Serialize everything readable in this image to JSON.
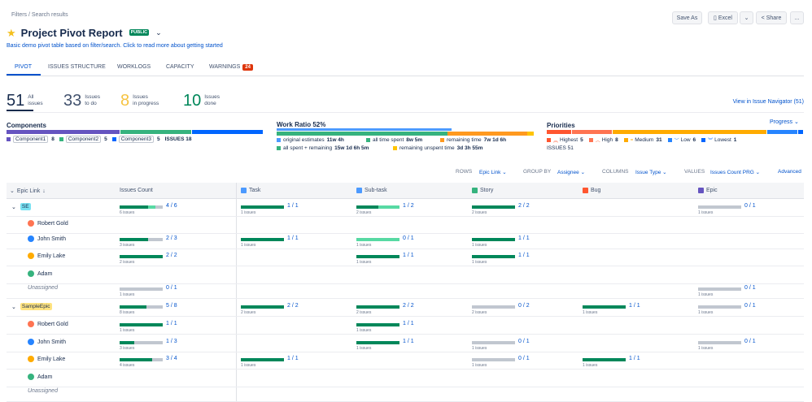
{
  "header": {
    "breadcrumb": "Filters  / Search results",
    "title": "Project Pivot Report",
    "badge": "PUBLIC",
    "subtitle": "Basic demo pivot table based on filter/search. Click to read more about getting started",
    "buttons": {
      "save_as": "Save As",
      "excel": "Excel",
      "share": "Share",
      "more": "..."
    }
  },
  "tabs": [
    {
      "label": "PIVOT"
    },
    {
      "label": "ISSUES STRUCTURE"
    },
    {
      "label": "WORKLOGS"
    },
    {
      "label": "CAPACITY"
    },
    {
      "label": "WARNINGS",
      "badge": "24"
    }
  ],
  "stats": [
    {
      "value": "51",
      "label1": "All",
      "label2": "issues",
      "color": "#172b4d"
    },
    {
      "value": "33",
      "label1": "Issues",
      "label2": "to do",
      "color": "#42526e"
    },
    {
      "value": "8",
      "label1": "Issues",
      "label2": "in progress",
      "color": "#f6c342"
    },
    {
      "value": "10",
      "label1": "Issues",
      "label2": "done",
      "color": "#00875a"
    }
  ],
  "issue_navigator_link": "View in Issue Navigator (51)",
  "components": {
    "title": "Components",
    "items": [
      {
        "name": "Component1",
        "count": "8",
        "color": "#6554c0",
        "share": 8
      },
      {
        "name": "Component2",
        "count": "5",
        "color": "#36b37e",
        "share": 5
      },
      {
        "name": "Component3",
        "count": "5",
        "color": "#0065ff",
        "share": 5
      }
    ],
    "issues_label": "ISSUES 18"
  },
  "work_ratio": {
    "title": "Work Ratio",
    "pct": "52%",
    "legend": [
      {
        "label": "original estimates",
        "value": "11w 4h",
        "color": "#4c9aff"
      },
      {
        "label": "all time spent",
        "value": "8w 5m",
        "color": "#36b37e"
      },
      {
        "label": "remaining time",
        "value": "7w 1d 6h",
        "color": "#ff991f"
      },
      {
        "label": "all spent + remaining",
        "value": "15w 1d 6h 5m",
        "color": "#36b37e"
      },
      {
        "label": "remaining unspent time",
        "value": "3d 3h 55m",
        "color": "#ffc400"
      }
    ]
  },
  "priorities": {
    "title": "Priorities",
    "progress_label": "Progress",
    "items": [
      {
        "name": "Highest",
        "count": "5",
        "color": "#ff5630",
        "icon": "highest-priority-icon",
        "glyph": "︽"
      },
      {
        "name": "High",
        "count": "8",
        "color": "#ff7452",
        "icon": "high-priority-icon",
        "glyph": "︿"
      },
      {
        "name": "Medium",
        "count": "31",
        "color": "#ffab00",
        "icon": "medium-priority-icon",
        "glyph": "="
      },
      {
        "name": "Low",
        "count": "6",
        "color": "#2684ff",
        "icon": "low-priority-icon",
        "glyph": "﹀"
      },
      {
        "name": "Lowest",
        "count": "1",
        "color": "#0065ff",
        "icon": "lowest-priority-icon",
        "glyph": "︾"
      }
    ],
    "issues_label": "ISSUES 51"
  },
  "controls": {
    "rows_label": "ROWS",
    "rows_value": "Epic Link",
    "group_label": "GROUP BY",
    "group_value": "Assignee",
    "columns_label": "COLUMNS",
    "columns_value": "Issue Type",
    "values_label": "VALUES",
    "values_value": "Issues Count PRG",
    "advanced": "Advanced"
  },
  "table": {
    "row_header": "Epic Link",
    "count_header": "Issues Count",
    "columns": [
      {
        "name": "Task",
        "color": "#4c9aff",
        "icon": "task-icon"
      },
      {
        "name": "Sub-task",
        "color": "#4c9aff",
        "icon": "subtask-icon"
      },
      {
        "name": "Story",
        "color": "#36b37e",
        "icon": "story-icon"
      },
      {
        "name": "Bug",
        "color": "#ff5630",
        "icon": "bug-icon"
      },
      {
        "name": "Epic",
        "color": "#6554c0",
        "icon": "epic-icon"
      }
    ],
    "rows": [
      {
        "label": "SE",
        "type": "epic",
        "tag_color": "#79e2f2",
        "total": {
          "done": 4,
          "prog": 1,
          "todo": 1,
          "text": "4 / 6",
          "sub": "6 issues"
        },
        "cells": [
          {
            "done": 1,
            "prog": 0,
            "todo": 0,
            "text": "1 / 1",
            "sub": "1 issues"
          },
          {
            "done": 1,
            "prog": 1,
            "todo": 0,
            "text": "1 / 2",
            "sub": "2 issues"
          },
          {
            "done": 2,
            "prog": 0,
            "todo": 0,
            "text": "2 / 2",
            "sub": "2 issues"
          },
          null,
          {
            "done": 0,
            "prog": 0,
            "todo": 1,
            "text": "0 / 1",
            "sub": "1 issues"
          }
        ]
      },
      {
        "label": "Robert Gold",
        "type": "user",
        "avatar": "#ff7452",
        "total": null,
        "cells": [
          null,
          null,
          null,
          null,
          null
        ]
      },
      {
        "label": "John Smith",
        "type": "user",
        "avatar": "#2684ff",
        "total": {
          "done": 2,
          "prog": 0,
          "todo": 1,
          "text": "2 / 3",
          "sub": "3 issues"
        },
        "cells": [
          {
            "done": 1,
            "prog": 0,
            "todo": 0,
            "text": "1 / 1",
            "sub": "1 issues"
          },
          {
            "done": 0,
            "prog": 1,
            "todo": 0,
            "text": "0 / 1",
            "sub": "1 issues"
          },
          {
            "done": 1,
            "prog": 0,
            "todo": 0,
            "text": "1 / 1",
            "sub": "1 issues"
          },
          null,
          null
        ]
      },
      {
        "label": "Emily Lake",
        "type": "user",
        "avatar": "#ffab00",
        "total": {
          "done": 2,
          "prog": 0,
          "todo": 0,
          "text": "2 / 2",
          "sub": "2 issues"
        },
        "cells": [
          null,
          {
            "done": 1,
            "prog": 0,
            "todo": 0,
            "text": "1 / 1",
            "sub": "1 issues"
          },
          {
            "done": 1,
            "prog": 0,
            "todo": 0,
            "text": "1 / 1",
            "sub": "1 issues"
          },
          null,
          null
        ]
      },
      {
        "label": "Adam",
        "type": "user",
        "avatar": "#36b37e",
        "total": null,
        "cells": [
          null,
          null,
          null,
          null,
          null
        ]
      },
      {
        "label": "Unassigned",
        "type": "unassigned",
        "total": {
          "done": 0,
          "prog": 0,
          "todo": 1,
          "text": "0 / 1",
          "sub": "1 issues"
        },
        "cells": [
          null,
          null,
          null,
          null,
          {
            "done": 0,
            "prog": 0,
            "todo": 1,
            "text": "0 / 1",
            "sub": "1 issues"
          }
        ]
      },
      {
        "label": "SampleEpic",
        "type": "epic",
        "tag_color": "#ffe380",
        "total": {
          "done": 5,
          "prog": 0,
          "todo": 3,
          "text": "5 / 8",
          "sub": "8 issues"
        },
        "cells": [
          {
            "done": 2,
            "prog": 0,
            "todo": 0,
            "text": "2 / 2",
            "sub": "2 issues"
          },
          {
            "done": 2,
            "prog": 0,
            "todo": 0,
            "text": "2 / 2",
            "sub": "2 issues"
          },
          {
            "done": 0,
            "prog": 0,
            "todo": 2,
            "text": "0 / 2",
            "sub": "2 issues"
          },
          {
            "done": 1,
            "prog": 0,
            "todo": 0,
            "text": "1 / 1",
            "sub": "1 issues"
          },
          {
            "done": 0,
            "prog": 0,
            "todo": 1,
            "text": "0 / 1",
            "sub": "1 issues"
          }
        ]
      },
      {
        "label": "Robert Gold",
        "type": "user",
        "avatar": "#ff7452",
        "total": {
          "done": 1,
          "prog": 0,
          "todo": 0,
          "text": "1 / 1",
          "sub": "1 issues"
        },
        "cells": [
          null,
          {
            "done": 1,
            "prog": 0,
            "todo": 0,
            "text": "1 / 1",
            "sub": "1 issues"
          },
          null,
          null,
          null
        ]
      },
      {
        "label": "John Smith",
        "type": "user",
        "avatar": "#2684ff",
        "total": {
          "done": 1,
          "prog": 0,
          "todo": 2,
          "text": "1 / 3",
          "sub": "3 issues"
        },
        "cells": [
          null,
          {
            "done": 1,
            "prog": 0,
            "todo": 0,
            "text": "1 / 1",
            "sub": "1 issues"
          },
          {
            "done": 0,
            "prog": 0,
            "todo": 1,
            "text": "0 / 1",
            "sub": "1 issues"
          },
          null,
          {
            "done": 0,
            "prog": 0,
            "todo": 1,
            "text": "0 / 1",
            "sub": "1 issues"
          }
        ]
      },
      {
        "label": "Emily Lake",
        "type": "user",
        "avatar": "#ffab00",
        "total": {
          "done": 3,
          "prog": 0,
          "todo": 1,
          "text": "3 / 4",
          "sub": "4 issues"
        },
        "cells": [
          {
            "done": 1,
            "prog": 0,
            "todo": 0,
            "text": "1 / 1",
            "sub": "1 issues"
          },
          null,
          {
            "done": 0,
            "prog": 0,
            "todo": 1,
            "text": "0 / 1",
            "sub": "1 issues"
          },
          {
            "done": 1,
            "prog": 0,
            "todo": 0,
            "text": "1 / 1",
            "sub": "1 issues"
          },
          null
        ]
      },
      {
        "label": "Adam",
        "type": "user",
        "avatar": "#36b37e",
        "total": null,
        "cells": [
          null,
          null,
          null,
          null,
          null
        ]
      },
      {
        "label": "Unassigned",
        "type": "unassigned",
        "total": null,
        "cells": [
          null,
          null,
          null,
          null,
          null
        ]
      }
    ]
  }
}
